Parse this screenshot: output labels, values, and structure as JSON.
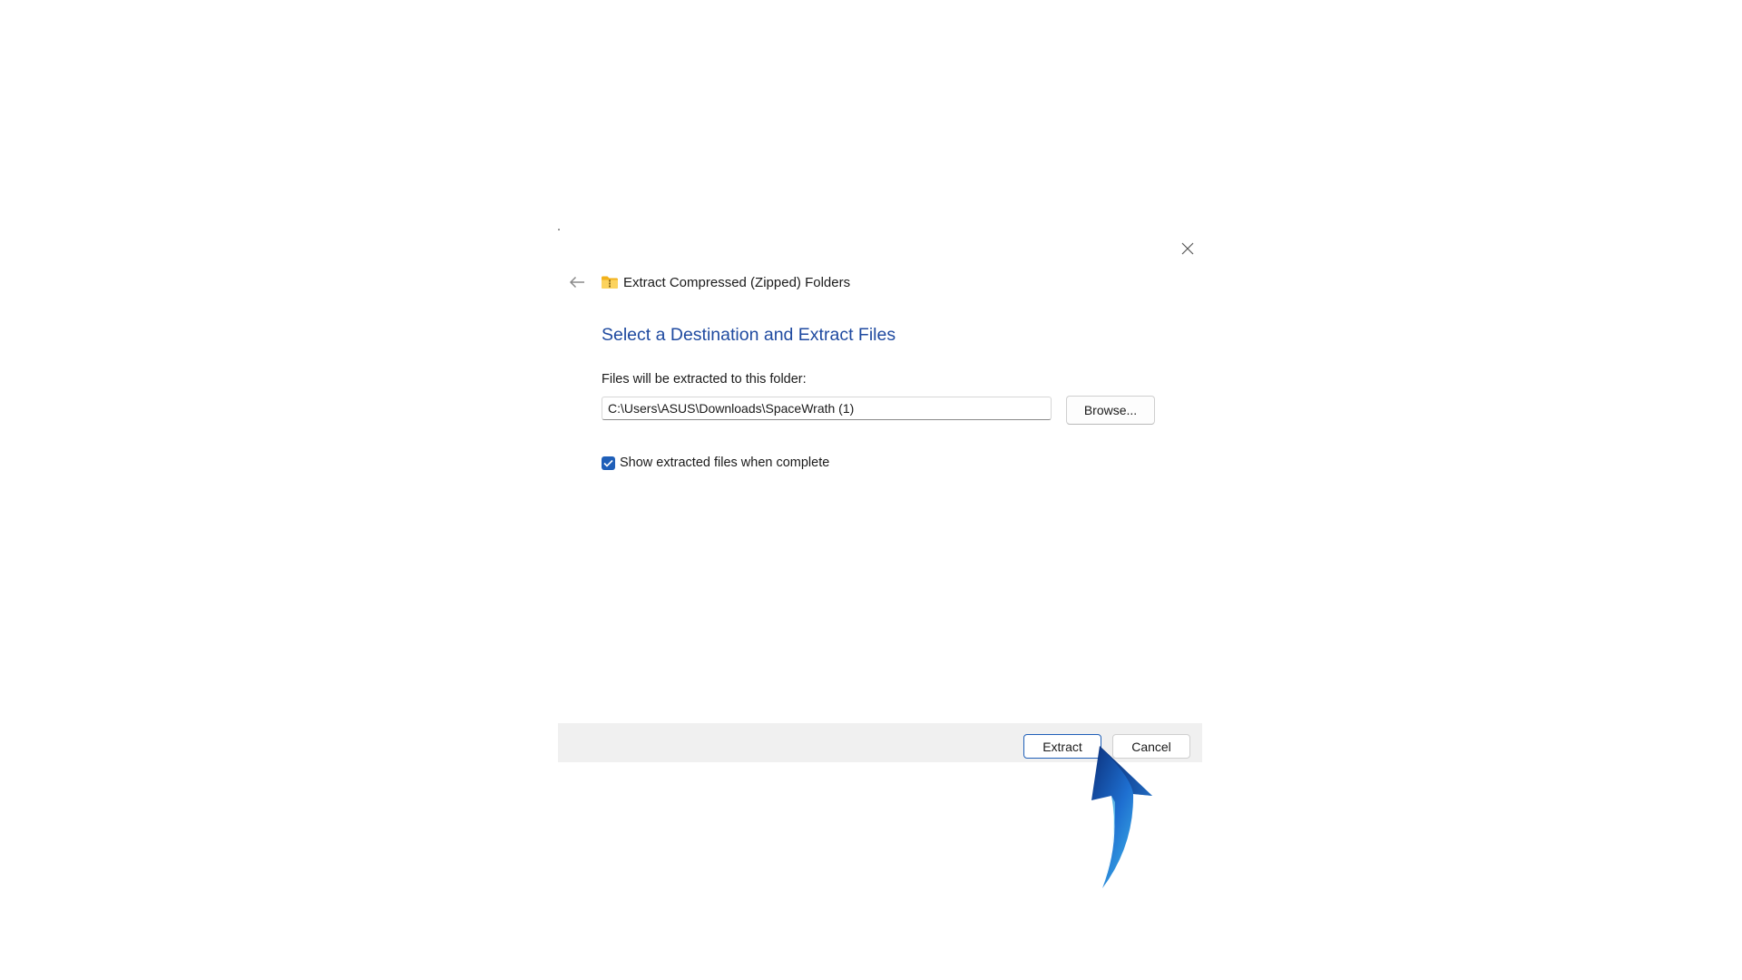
{
  "dialog": {
    "window_title": "Extract Compressed (Zipped) Folders",
    "heading": "Select a Destination and Extract Files",
    "destination_label": "Files will be extracted to this folder:",
    "destination_path": "C:\\Users\\ASUS\\Downloads\\SpaceWrath (1)",
    "browse_label": "Browse...",
    "show_files_label": "Show extracted files when complete",
    "show_files_checked": true
  },
  "footer": {
    "extract_label": "Extract",
    "cancel_label": "Cancel"
  },
  "icons": {
    "back": "back-arrow-icon",
    "folder": "zipped-folder-icon",
    "close": "close-icon",
    "check": "checkmark-icon",
    "pointer": "pointer-arrow-icon"
  },
  "colors": {
    "heading": "#1f4aa0",
    "accent": "#1f5fb8",
    "footer_bg": "#f0f0f0"
  }
}
